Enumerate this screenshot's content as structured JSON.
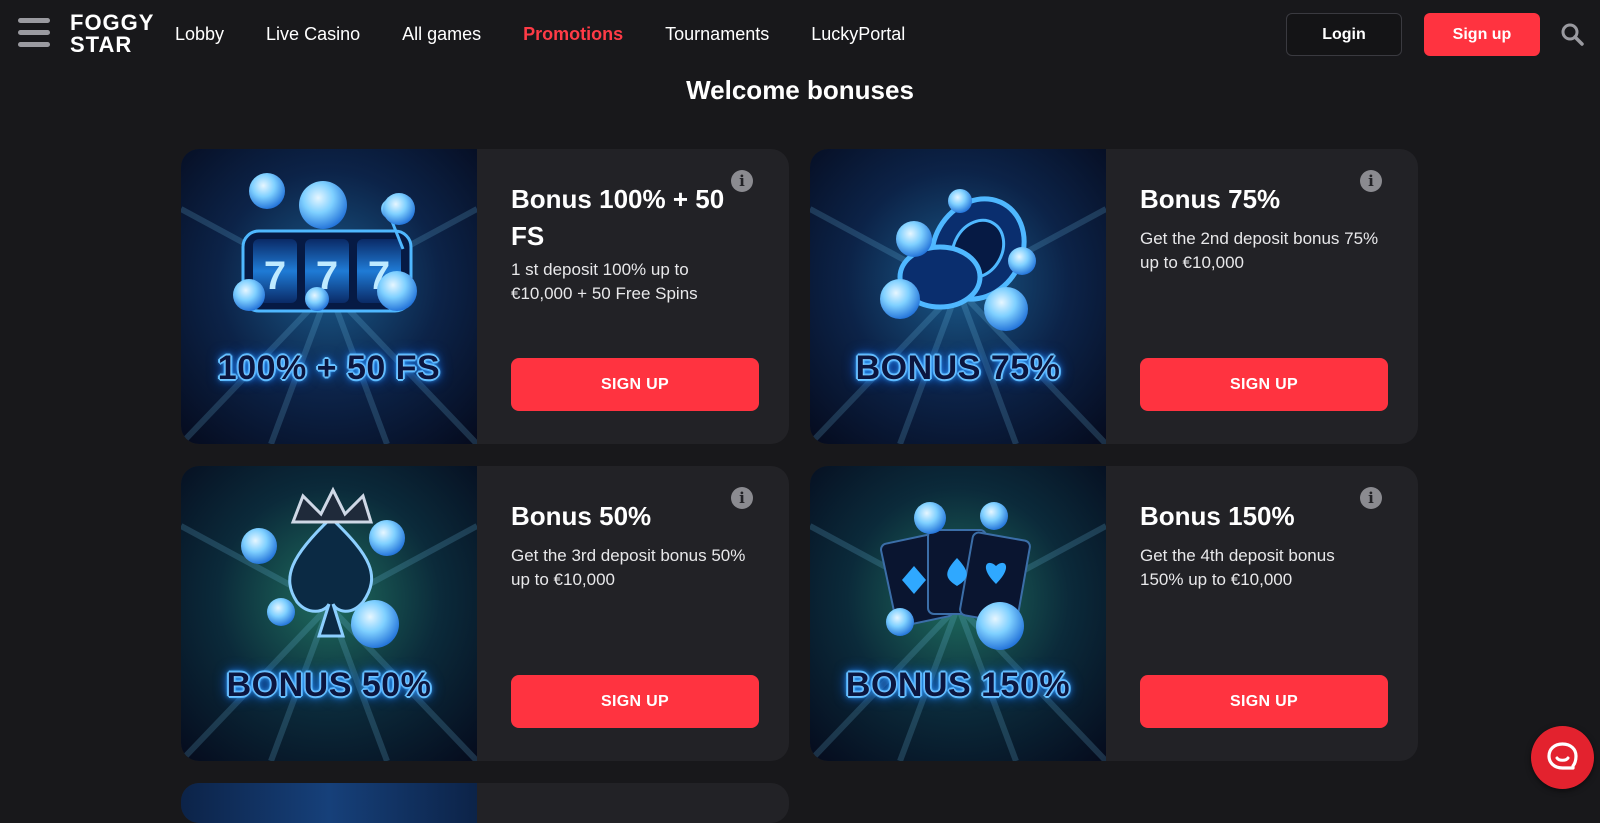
{
  "header": {
    "logo": {
      "line1": "FOGGY",
      "line2": "STAR"
    },
    "nav": [
      {
        "label": "Lobby",
        "active": false
      },
      {
        "label": "Live Casino",
        "active": false
      },
      {
        "label": "All games",
        "active": false
      },
      {
        "label": "Promotions",
        "active": true
      },
      {
        "label": "Tournaments",
        "active": false
      },
      {
        "label": "LuckyPortal",
        "active": false
      }
    ],
    "login_label": "Login",
    "signup_label": "Sign up"
  },
  "page_title": "Welcome bonuses",
  "cards": [
    {
      "art_caption": "100% + 50 FS",
      "art_icon": "slot-machine-777",
      "title": "Bonus 100% + 50 FS",
      "description": "1 st deposit 100% up to €10,000 + 50 Free Spins",
      "cta": "SIGN UP"
    },
    {
      "art_caption": "BONUS 75%",
      "art_icon": "poker-chips",
      "title": "Bonus 75%",
      "description": "Get the 2nd deposit bonus 75% up to €10,000",
      "cta": "SIGN UP"
    },
    {
      "art_caption": "BONUS 50%",
      "art_icon": "crowned-spade",
      "title": "Bonus 50%",
      "description": "Get the 3rd deposit bonus 50% up to €10,000",
      "cta": "SIGN UP"
    },
    {
      "art_caption": "BONUS 150%",
      "art_icon": "playing-cards",
      "title": "Bonus 150%",
      "description": "Get the 4th deposit bonus 150% up to €10,000",
      "cta": "SIGN UP"
    }
  ],
  "colors": {
    "background": "#18181b",
    "card": "#222226",
    "accent": "#ff3340",
    "neon_blue": "#4fb8ff"
  },
  "icons": {
    "menu": "hamburger-icon",
    "search": "search-icon",
    "info": "info-icon",
    "chat": "chat-icon"
  }
}
